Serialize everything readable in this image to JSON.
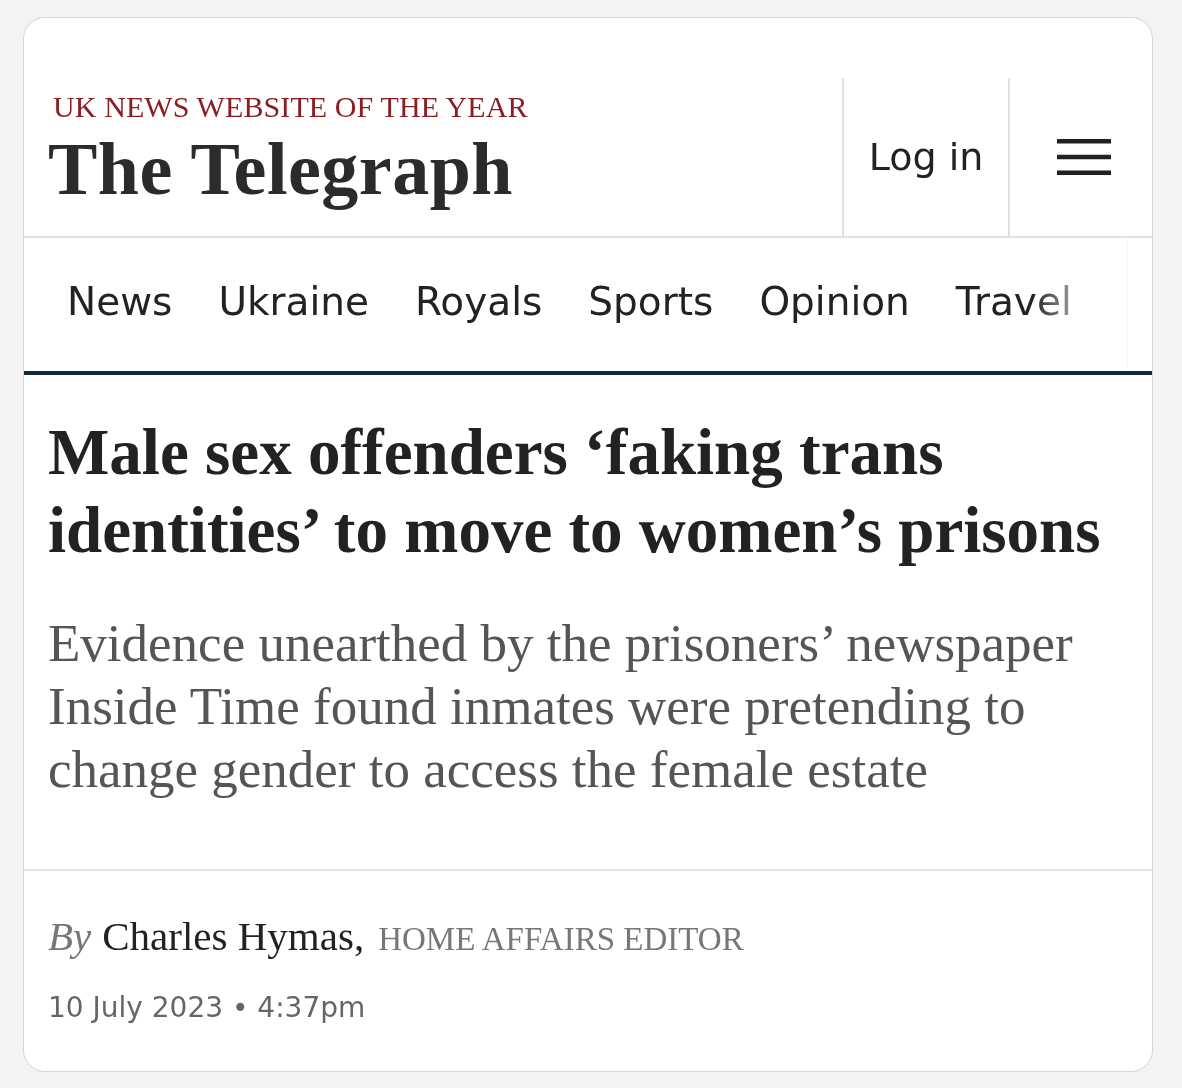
{
  "header": {
    "award": "UK NEWS WEBSITE OF THE YEAR",
    "logo": "The Telegraph",
    "login": "Log in"
  },
  "nav": {
    "items": [
      {
        "label": "News"
      },
      {
        "label": "Ukraine"
      },
      {
        "label": "Royals"
      },
      {
        "label": "Sports"
      },
      {
        "label": "Opinion"
      },
      {
        "label": "Travel"
      }
    ]
  },
  "article": {
    "headline": "Male sex offenders ‘faking trans identities’ to move to women’s prisons",
    "standfirst": "Evidence unearthed by the prisoners’ newspaper Inside Time found inmates were pretending to change gender to access the female estate",
    "byline": {
      "prefix": "By",
      "author": "Charles Hymas,",
      "role": "HOME AFFAIRS EDITOR"
    },
    "published": "10 July 2023 • 4:37pm"
  }
}
